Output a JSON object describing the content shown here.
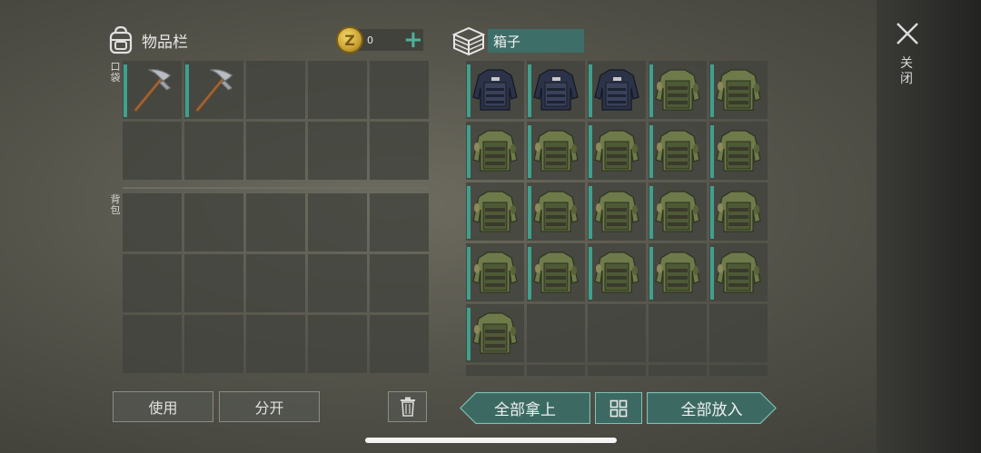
{
  "inventory": {
    "title": "物品栏",
    "pocket_label": "口袋",
    "backpack_label": "背包",
    "coins": {
      "value": "0",
      "icon": "coin-z-icon",
      "add": "plus-icon"
    },
    "pocket_items": [
      "pickaxe",
      "pickaxe",
      "",
      "",
      "",
      "",
      "",
      "",
      "",
      ""
    ],
    "backpack_items": [
      "",
      "",
      "",
      "",
      "",
      "",
      "",
      "",
      "",
      "",
      "",
      "",
      "",
      "",
      ""
    ]
  },
  "box": {
    "title": "箱子",
    "items": [
      "police-vest",
      "police-vest",
      "police-vest",
      "camo-vest",
      "camo-vest",
      "camo-vest",
      "camo-vest",
      "camo-vest",
      "camo-vest",
      "camo-vest",
      "camo-vest",
      "camo-vest",
      "camo-vest",
      "camo-vest",
      "camo-vest",
      "camo-vest",
      "camo-vest",
      "camo-vest",
      "camo-vest",
      "camo-vest",
      "camo-vest",
      "",
      "",
      "",
      ""
    ]
  },
  "buttons": {
    "use": "使用",
    "split": "分开",
    "take_all": "全部拿上",
    "put_all": "全部放入"
  },
  "close": {
    "label": "关闭",
    "icon": "close-icon"
  },
  "colors": {
    "accent": "#3fa08e",
    "panel": "#40423c",
    "teal_button": "#3c6a63"
  }
}
